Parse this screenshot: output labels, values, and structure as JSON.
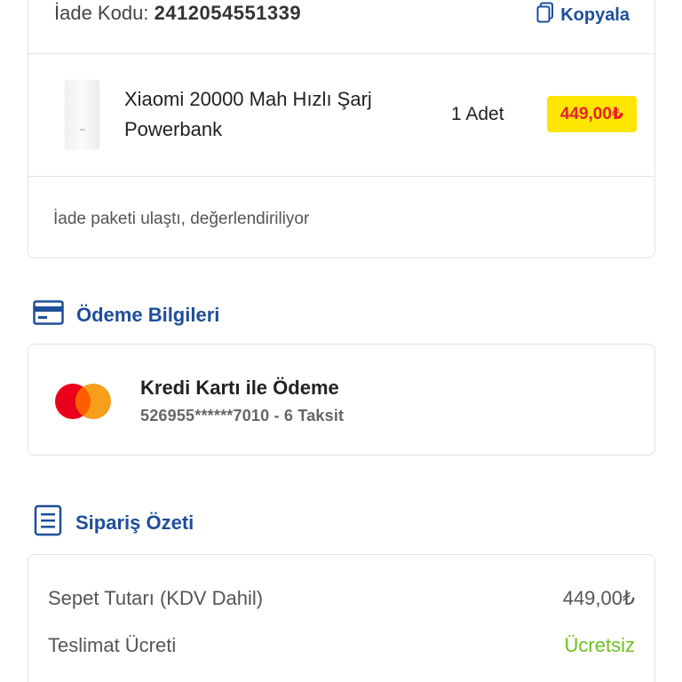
{
  "return_card": {
    "code_label": "İade Kodu:",
    "code_value": "2412054551339",
    "copy_label": "Kopyala",
    "product": {
      "name": "Xiaomi 20000 Mah Hızlı Şarj Powerbank",
      "quantity": "1 Adet",
      "price": "449,00₺"
    },
    "status": "İade paketi ulaştı, değerlendiriliyor"
  },
  "payment_section": {
    "title": "Ödeme Bilgileri",
    "method": "Kredi Kartı ile Ödeme",
    "card_info": "526955******7010 - 6 Taksit"
  },
  "summary_section": {
    "title": "Sipariş Özeti",
    "rows": [
      {
        "label": "Sepet Tutarı (KDV Dahil)",
        "value": "449,00₺"
      },
      {
        "label": "Teslimat Ücreti",
        "value": "Ücretsiz"
      }
    ]
  },
  "colors": {
    "accent": "#1e4e9a",
    "price_badge_bg": "#ffe600",
    "price_text": "#e5202a",
    "free_text": "#6cc11f"
  },
  "icons": {
    "copy": "copy-icon",
    "payment": "credit-card-icon",
    "summary": "document-list-icon",
    "card_brand": "mastercard-logo"
  }
}
